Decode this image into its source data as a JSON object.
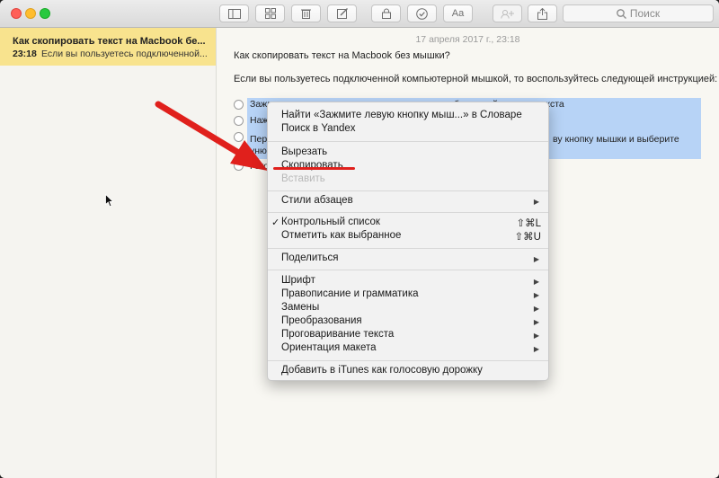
{
  "toolbar": {
    "search_placeholder": "Поиск",
    "font_button_label": "Aa"
  },
  "sidebar": {
    "notes": [
      {
        "title": "Как скопировать текст на Macbook бе...",
        "time": "23:18",
        "preview": "Если вы пользуетесь подключенной..."
      }
    ]
  },
  "editor": {
    "date": "17 апреля 2017 г., 23:18",
    "heading": "Как скопировать текст на Macbook без мышки?",
    "intro": "Если вы пользуетесь подключенной компьютерной мышкой, то воспользуйтесь следующей инструкцией:",
    "checklist": [
      "Зажмите левую кнопку мышки и выделите необходимый участок текста",
      "Наж",
      "Пер",
      "уню",
      "Гото"
    ],
    "checklist_tail": "ву кнопку мышки и выберите"
  },
  "context_menu": {
    "lookup": "Найти «Зажмите левую кнопку мыш...» в Словаре",
    "search_yandex": "Поиск в Yandex",
    "cut": "Вырезать",
    "copy": "Скопировать",
    "paste": "Вставить",
    "paragraph_styles": "Стили абзацев",
    "checklist": "Контрольный список",
    "checklist_shortcut": "⇧⌘L",
    "mark_checked": "Отметить как выбранное",
    "mark_checked_shortcut": "⇧⌘U",
    "share": "Поделиться",
    "font": "Шрифт",
    "spelling": "Правописание и грамматика",
    "substitutions": "Замены",
    "transformations": "Преобразования",
    "speech": "Проговаривание текста",
    "layout_orientation": "Ориентация макета",
    "add_itunes": "Добавить в iTunes как голосовую дорожку",
    "submenu_glyph": "▶",
    "check_glyph": "✓"
  },
  "colors": {
    "selected_note": "#f8e38e",
    "selection": "#b7d3f6",
    "annotation_red": "#e0201c"
  }
}
